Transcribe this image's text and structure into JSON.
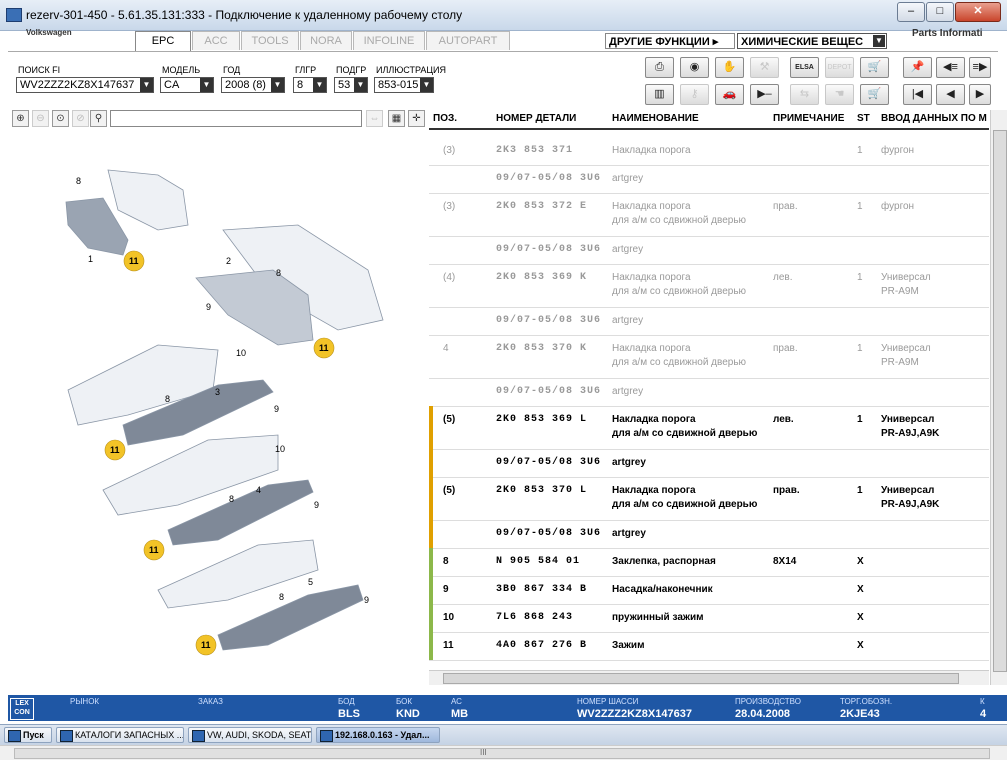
{
  "window": {
    "title": "rezerv-301-450 - 5.61.35.131:333 - Подключение к удаленному рабочему столу"
  },
  "brand": "Volkswagen",
  "tabs": [
    {
      "label": "EPC",
      "active": true
    },
    {
      "label": "ACC",
      "active": false
    },
    {
      "label": "TOOLS",
      "active": false
    },
    {
      "label": "NORA",
      "active": false
    },
    {
      "label": "INFOLINE",
      "active": false
    },
    {
      "label": "AUTOPART",
      "active": false
    }
  ],
  "functions": {
    "other_label": "ДРУГИЕ ФУНКЦИИ ▸",
    "chem_label": "ХИМИЧЕСКИЕ ВЕЩЕС"
  },
  "parts_info": "Parts Informati",
  "filters": {
    "fi": {
      "label": "ПОИСК FI",
      "value": "WV2ZZZ2KZ8X147637"
    },
    "model": {
      "label": "МОДЕЛЬ",
      "value": "CA"
    },
    "year": {
      "label": "ГОД",
      "value": "2008 (8)"
    },
    "group": {
      "label": "ГЛГР",
      "value": "8"
    },
    "subgroup": {
      "label": "ПОДГР",
      "value": "53"
    },
    "illustration": {
      "label": "ИЛЛЮСТРАЦИЯ",
      "value": "853-015"
    }
  },
  "toolbar": {
    "print": "print-icon",
    "camera": "camera-icon",
    "handshake": "handshake-icon",
    "tools": "tools-icon",
    "elsa": "ELSA",
    "depot": "DEPOT",
    "cart_add": "cart-add-icon",
    "pin": "pin-icon",
    "list_prev": "list-prev-icon",
    "list_next": "list-next-icon",
    "barcode": "barcode-icon",
    "key": "key-icon",
    "car": "car-icon",
    "arrow_bar": "arrow-bar-icon",
    "first": "first-icon",
    "prev": "prev-icon",
    "next": "next-icon"
  },
  "table": {
    "headers": {
      "pos": "ПОЗ.",
      "part": "НОМЕР ДЕТАЛИ",
      "name": "НАИМЕНОВАНИЕ",
      "note": "ПРИМЕЧАНИЕ",
      "st": "ST",
      "input": "ВВОД ДАННЫХ ПО М"
    },
    "rows": [
      {
        "pos": "(3)",
        "part": "2K3 853 371",
        "name": "Накладка порога",
        "name2": "",
        "note": "",
        "st": "1",
        "input": "фургон",
        "input2": "",
        "style": "grey",
        "mark": ""
      },
      {
        "pos": "",
        "part": "09/07-05/08 3U6",
        "name": "artgrey",
        "name2": "",
        "note": "",
        "st": "",
        "input": "",
        "input2": "",
        "style": "grey",
        "mark": ""
      },
      {
        "pos": "(3)",
        "part": "2K0 853 372 E",
        "name": "Накладка порога",
        "name2": "для а/м со сдвижной дверью",
        "note": "прав.",
        "st": "1",
        "input": "фургон",
        "input2": "",
        "style": "grey",
        "mark": ""
      },
      {
        "pos": "",
        "part": "09/07-05/08 3U6",
        "name": "artgrey",
        "name2": "",
        "note": "",
        "st": "",
        "input": "",
        "input2": "",
        "style": "grey",
        "mark": ""
      },
      {
        "pos": "(4)",
        "part": "2K0 853 369 K",
        "name": "Накладка порога",
        "name2": "для а/м со сдвижной дверью",
        "note": "лев.",
        "st": "1",
        "input": "Универсал",
        "input2": "PR-A9M",
        "style": "grey",
        "mark": ""
      },
      {
        "pos": "",
        "part": "09/07-05/08 3U6",
        "name": "artgrey",
        "name2": "",
        "note": "",
        "st": "",
        "input": "",
        "input2": "",
        "style": "grey",
        "mark": ""
      },
      {
        "pos": "4",
        "part": "2K0 853 370 K",
        "name": "Накладка порога",
        "name2": "для а/м со сдвижной дверью",
        "note": "прав.",
        "st": "1",
        "input": "Универсал",
        "input2": "PR-A9M",
        "style": "grey",
        "mark": ""
      },
      {
        "pos": "",
        "part": "09/07-05/08 3U6",
        "name": "artgrey",
        "name2": "",
        "note": "",
        "st": "",
        "input": "",
        "input2": "",
        "style": "grey",
        "mark": ""
      },
      {
        "pos": "(5)",
        "part": "2K0 853 369 L",
        "name": "Накладка порога",
        "name2": "для а/м со сдвижной дверью",
        "note": "лев.",
        "st": "1",
        "input": "Универсал",
        "input2": "PR-A9J,A9K",
        "style": "black",
        "mark": "#e0a000"
      },
      {
        "pos": "",
        "part": "09/07-05/08 3U6",
        "name": "artgrey",
        "name2": "",
        "note": "",
        "st": "",
        "input": "",
        "input2": "",
        "style": "black",
        "mark": "#e0a000"
      },
      {
        "pos": "(5)",
        "part": "2K0 853 370 L",
        "name": "Накладка порога",
        "name2": "для а/м со сдвижной дверью",
        "note": "прав.",
        "st": "1",
        "input": "Универсал",
        "input2": "PR-A9J,A9K",
        "style": "black",
        "mark": "#e0a000"
      },
      {
        "pos": "",
        "part": "09/07-05/08 3U6",
        "name": "artgrey",
        "name2": "",
        "note": "",
        "st": "",
        "input": "",
        "input2": "",
        "style": "black",
        "mark": "#e0a000"
      },
      {
        "pos": "8",
        "part": "N 905 584 01",
        "name": "Заклепка, распорная",
        "name2": "",
        "note": "8X14",
        "st": "X",
        "input": "",
        "input2": "",
        "style": "black",
        "mark": "#8cb84a"
      },
      {
        "pos": "9",
        "part": "3B0 867 334 B",
        "name": "Насадка/наконечник",
        "name2": "",
        "note": "",
        "st": "X",
        "input": "",
        "input2": "",
        "style": "black",
        "mark": "#8cb84a"
      },
      {
        "pos": "10",
        "part": "7L6 868 243",
        "name": "пружинный зажим",
        "name2": "",
        "note": "",
        "st": "X",
        "input": "",
        "input2": "",
        "style": "black",
        "mark": "#8cb84a"
      },
      {
        "pos": "11",
        "part": "4A0 867 276 B",
        "name": "Зажим",
        "name2": "",
        "note": "",
        "st": "X",
        "input": "",
        "input2": "",
        "style": "black",
        "mark": "#8cb84a"
      }
    ]
  },
  "illustration": {
    "labels": [
      "8",
      "1",
      "11",
      "2",
      "8",
      "9",
      "11",
      "10",
      "3",
      "8",
      "9",
      "11",
      "10",
      "8",
      "4",
      "9",
      "11",
      "8",
      "5",
      "9",
      "11"
    ]
  },
  "status": {
    "lexcon": "LEX CON",
    "market": {
      "label": "РЫНОК",
      "value": ""
    },
    "order": {
      "label": "ЗАКАЗ",
      "value": ""
    },
    "bod": {
      "label": "БОД",
      "value": "BLS"
    },
    "bok": {
      "label": "БОК",
      "value": "KND"
    },
    "ac": {
      "label": "АС",
      "value": "MB"
    },
    "vin": {
      "label": "НОМЕР ШАССИ",
      "value": "WV2ZZZ2KZ8X147637"
    },
    "prod": {
      "label": "ПРОИЗВОДСТВО",
      "value": "28.04.2008"
    },
    "torg": {
      "label": "ТОРГ.ОБОЗН.",
      "value": "2KJE43"
    },
    "k": {
      "label": "К",
      "value": "4"
    }
  },
  "taskbar": {
    "start": "Пуск",
    "items": [
      "КАТАЛОГИ ЗАПАСНЫХ ...",
      "VW, AUDI, SKODA, SEAT",
      "192.168.0.163 - Удал..."
    ]
  },
  "colors": {
    "status_bar": "#1f57a5",
    "callout": "#f2c327",
    "accent_orange": "#e0a000",
    "accent_green": "#8cb84a"
  }
}
